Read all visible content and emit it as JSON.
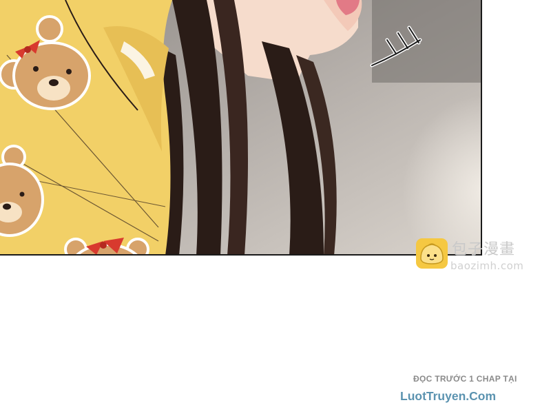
{
  "watermark": {
    "title": "包子漫畫",
    "subtitle": "baozimh.com",
    "logo_icon": "bun-mascot-icon"
  },
  "footer": {
    "promo_line": "ĐỌC TRƯỚC 1 CHAP TẠI",
    "site_name": "LuotTruyen.Com"
  },
  "colors": {
    "shirt_yellow": "#f2d067",
    "hair_dark": "#2a1c17",
    "skin": "#f6dccc",
    "bear_tan": "#d7a36b",
    "bow_red": "#d83a2e",
    "site_blue": "#5b93b0",
    "logo_yellow": "#f5c842"
  }
}
